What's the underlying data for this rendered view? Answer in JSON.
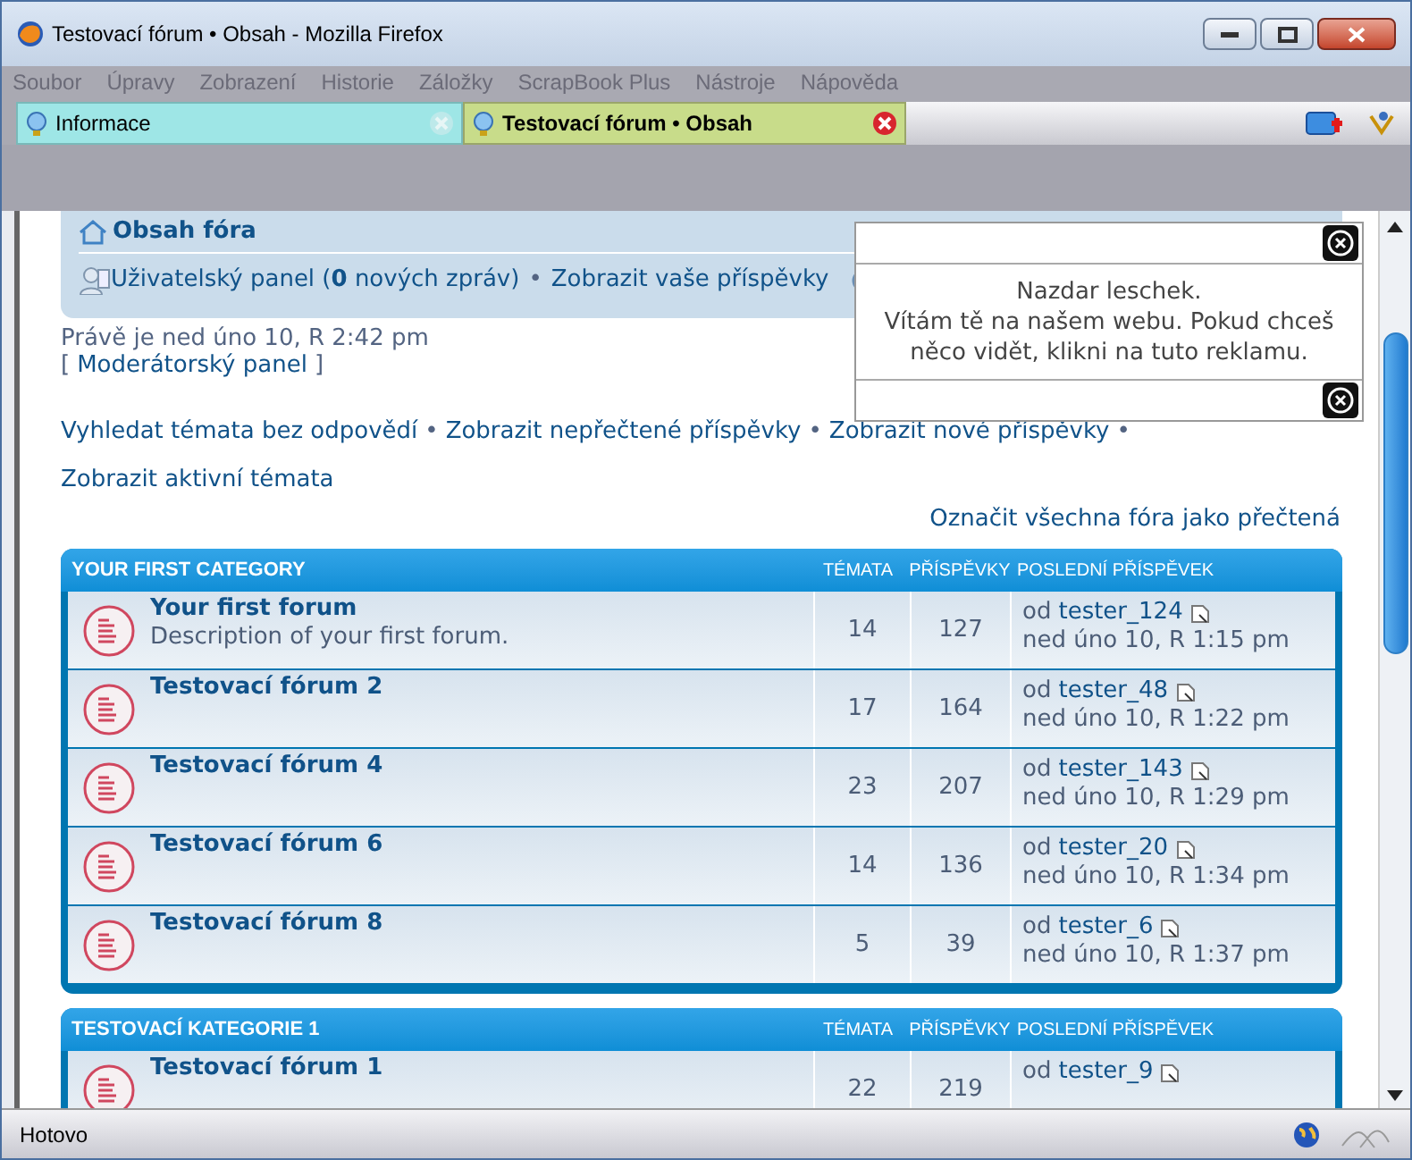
{
  "window": {
    "title": "Testovací fórum • Obsah - Mozilla Firefox"
  },
  "menu": [
    "Soubor",
    "Úpravy",
    "Zobrazení",
    "Historie",
    "Záložky",
    "ScrapBook Plus",
    "Nástroje",
    "Nápověda"
  ],
  "tabs": [
    {
      "label": "Informace",
      "selected": false
    },
    {
      "label": "Testovací fórum • Obsah",
      "selected": true
    }
  ],
  "navbar": {
    "index_link": "Obsah fóra",
    "user_panel": "Uživatelský panel (**0** nových zpráv)",
    "separator": "•",
    "own_posts": "Zobrazit vaše příspěvky"
  },
  "current_time": "Právě je ned úno 10, R 2:42 pm",
  "moderator_panel": {
    "open": "[",
    "label": "Moderátorský panel",
    "close": "]"
  },
  "quick_links": [
    {
      "label": "Vyhledat témata bez odpovědí"
    },
    {
      "label": "Zobrazit nepřečtené příspěvky"
    },
    {
      "label": "Zobrazit nové příspěvky"
    },
    {
      "label": "Zobrazit aktivní témata"
    }
  ],
  "mark_read": "Označit všechna fóra jako přečtená",
  "categories": [
    {
      "title": "YOUR FIRST CATEGORY",
      "columns": [
        "TÉMATA",
        "PŘÍSPĚVKY",
        "POSLEDNÍ PŘÍSPĚVEK"
      ],
      "forums": [
        {
          "name": "Your first forum",
          "description": "Description of your first forum.",
          "topics": "14",
          "posts": "127",
          "last_by": "od",
          "last_user": "tester_124",
          "last_date": "ned úno 10, R 1:15 pm"
        },
        {
          "name": "Testovací fórum 2",
          "topics": "17",
          "posts": "164",
          "last_by": "od",
          "last_user": "tester_48",
          "last_date": "ned úno 10, R 1:22 pm"
        },
        {
          "name": "Testovací fórum 4",
          "topics": "23",
          "posts": "207",
          "last_by": "od",
          "last_user": "tester_143",
          "last_date": "ned úno 10, R 1:29 pm"
        },
        {
          "name": "Testovací fórum 6",
          "topics": "14",
          "posts": "136",
          "last_by": "od",
          "last_user": "tester_20",
          "last_date": "ned úno 10, R 1:34 pm"
        },
        {
          "name": "Testovací fórum 8",
          "topics": "5",
          "posts": "39",
          "last_by": "od",
          "last_user": "tester_6",
          "last_date": "ned úno 10, R 1:37 pm"
        }
      ]
    },
    {
      "title": "TESTOVACÍ KATEGORIE 1",
      "columns": [
        "TÉMATA",
        "PŘÍSPĚVKY",
        "POSLEDNÍ PŘÍSPĚVEK"
      ],
      "forums": [
        {
          "name": "Testovací fórum 1",
          "topics": "22",
          "posts": "219",
          "last_by": "od",
          "last_user": "tester_9"
        }
      ]
    }
  ],
  "ad_popup": {
    "lines": [
      "Nazdar leschek.",
      "Vítám tě na našem webu. Pokud chceš něco vidět, klikni na tuto reklamu."
    ]
  },
  "status_bar": {
    "text": "Hotovo"
  }
}
